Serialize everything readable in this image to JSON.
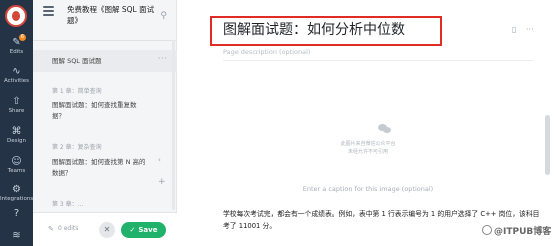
{
  "rail": {
    "badge_count": "6",
    "items": [
      {
        "icon": "pencil-icon",
        "glyph": "✎",
        "label": "Edits"
      },
      {
        "icon": "pulse-icon",
        "glyph": "∿",
        "label": "Activities"
      },
      {
        "icon": "share-icon",
        "glyph": "⇧",
        "label": "Share"
      },
      {
        "icon": "design-icon",
        "glyph": "⌘",
        "label": "Design"
      },
      {
        "icon": "team-icon",
        "glyph": "☺",
        "label": "Teams"
      },
      {
        "icon": "integrations-icon",
        "glyph": "⚙",
        "label": "Integrations"
      },
      {
        "icon": "help-icon",
        "glyph": "?",
        "label": ""
      },
      {
        "icon": "layers-icon",
        "glyph": "≋",
        "label": ""
      }
    ]
  },
  "outline": {
    "doc_title": "免费教程《图解 SQL 面试题》",
    "active_item": "图解 SQL 面试题",
    "more_dots": "···",
    "sections": [
      {
        "heading": "第 1 章：简单查询",
        "entry": "图解面试题：如何查找重复数据？"
      },
      {
        "heading": "第 2 章：复杂查询",
        "entry": "图解面试题：如何查找第 N 高的数据？"
      }
    ],
    "extra_section": "第 3 章：…",
    "plus": "+",
    "collapse": "‹"
  },
  "savebar": {
    "edits_text": "0 edits",
    "cancel_glyph": "✕",
    "save_label": "Save",
    "save_check": "✓"
  },
  "main": {
    "page_title": "图解面试题：如何分析中位数",
    "description_placeholder": "Page description (optional)",
    "image_lines": [
      "此图片来自微信公众平台",
      "未经允许不可引用"
    ],
    "caption_placeholder": "Enter a caption for this image (optional)",
    "body_text": "学校每次考试完，都会有一个成绩表。例如，表中第 1 行表示编号为 1 的用户选择了 C++ 岗位，该科目考了 11001 分。",
    "tool_doc_glyph": "▯",
    "tool_more_glyph": "···"
  },
  "watermark": "@ITPUB博客",
  "colors": {
    "rail_bg": "#253347",
    "save_green": "#20b26b",
    "highlight_red": "#e02b27",
    "badge_orange": "#f08a24"
  }
}
